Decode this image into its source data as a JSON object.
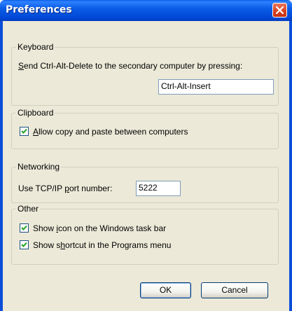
{
  "window": {
    "title": "Preferences"
  },
  "keyboard": {
    "group_label": "Keyboard",
    "description_prefix": "S",
    "description_rest": "end Ctrl-Alt-Delete to the secondary computer by pressing:",
    "value": "Ctrl-Alt-Insert"
  },
  "clipboard": {
    "group_label": "Clipboard",
    "checkbox_prefix": "A",
    "checkbox_rest": "llow copy and paste between computers",
    "checked": true
  },
  "networking": {
    "group_label": "Networking",
    "label_before": "Use TCP/IP ",
    "label_u": "p",
    "label_after": "ort number:",
    "port_value": "5222"
  },
  "other": {
    "group_label": "Other",
    "taskbar_before": "Show ",
    "taskbar_u": "i",
    "taskbar_after": "con on the Windows task bar",
    "taskbar_checked": true,
    "programs_before": "Show s",
    "programs_u": "h",
    "programs_after": "ortcut in the Programs menu",
    "programs_checked": true
  },
  "buttons": {
    "ok": "OK",
    "cancel": "Cancel"
  }
}
